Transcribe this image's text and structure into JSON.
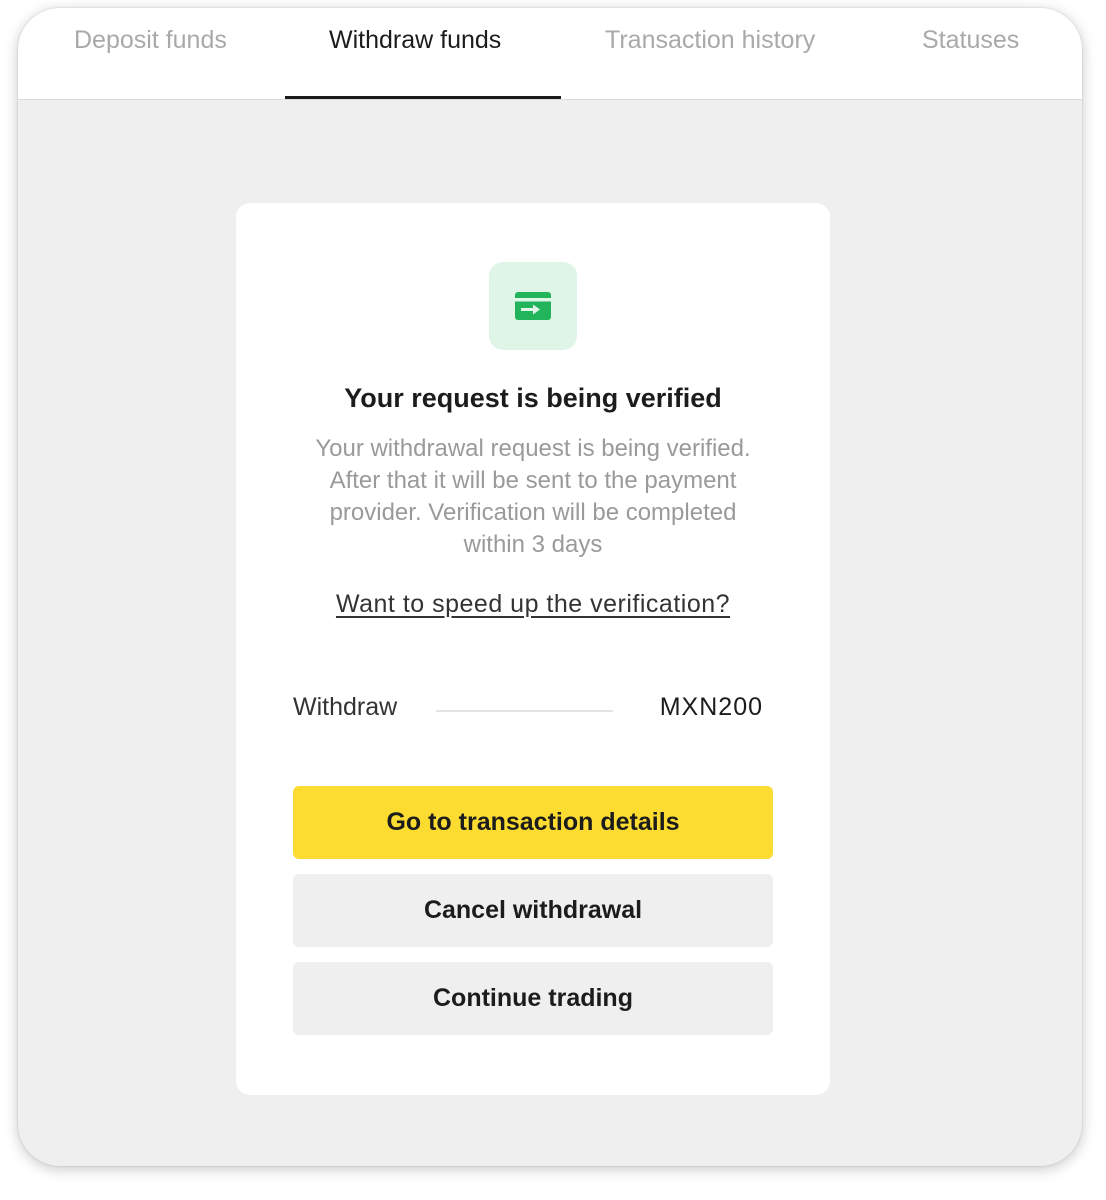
{
  "tabs": [
    {
      "label": "Deposit funds",
      "active": false
    },
    {
      "label": "Withdraw funds",
      "active": true
    },
    {
      "label": "Transaction history",
      "active": false
    },
    {
      "label": "Statuses",
      "active": false
    }
  ],
  "card": {
    "icon": "card-transfer-icon",
    "icon_color": "#21b45b",
    "icon_bg": "#dff5e7",
    "title": "Your request is being verified",
    "description": "Your withdrawal request is being verified. After that it will be sent to the payment provider. Verification will be completed within 3 days",
    "speed_up_link": "Want to speed up the verification?",
    "summary": {
      "label": "Withdraw",
      "value": "MXN200"
    },
    "buttons": {
      "transaction_details": "Go to transaction details",
      "cancel_withdrawal": "Cancel withdrawal",
      "continue_trading": "Continue trading"
    }
  },
  "colors": {
    "primary_button": "#fddc32",
    "secondary_button": "#efefef",
    "page_background": "#efefef"
  }
}
